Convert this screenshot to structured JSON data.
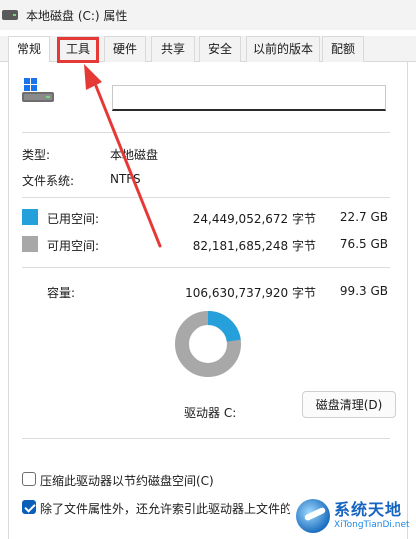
{
  "window": {
    "title": "本地磁盘 (C:) 属性"
  },
  "tabs": [
    {
      "label": "常规",
      "active": true
    },
    {
      "label": "工具",
      "active": false
    },
    {
      "label": "硬件",
      "active": false
    },
    {
      "label": "共享",
      "active": false
    },
    {
      "label": "安全",
      "active": false
    },
    {
      "label": "以前的版本",
      "active": false
    },
    {
      "label": "配额",
      "active": false
    }
  ],
  "drive_name": {
    "value": ""
  },
  "info": {
    "type_label": "类型:",
    "type_value": "本地磁盘",
    "fs_label": "文件系统:",
    "fs_value": "NTFS"
  },
  "space": {
    "used_label": "已用空间:",
    "used_bytes": "24,449,052,672 字节",
    "used_gb": "22.7 GB",
    "used_color": "#26a0da",
    "free_label": "可用空间:",
    "free_bytes": "82,181,685,248 字节",
    "free_gb": "76.5 GB",
    "free_color": "#a8a8a8",
    "capacity_label": "容量:",
    "capacity_bytes": "106,630,737,920 字节",
    "capacity_gb": "99.3 GB",
    "used_fraction": 0.229
  },
  "drive_label": "驱动器 C:",
  "cleanup_button": "磁盘清理(D)",
  "options": {
    "compress_label": "压缩此驱动器以节约磁盘空间(C)",
    "compress_checked": false,
    "index_label": "除了文件属性外，还允许索引此驱动器上文件的内",
    "index_checked": true
  },
  "annotation": {
    "highlight_color": "#e53935"
  },
  "watermark": {
    "title": "系统天地",
    "subtitle": "XiTongTianDi.net"
  }
}
